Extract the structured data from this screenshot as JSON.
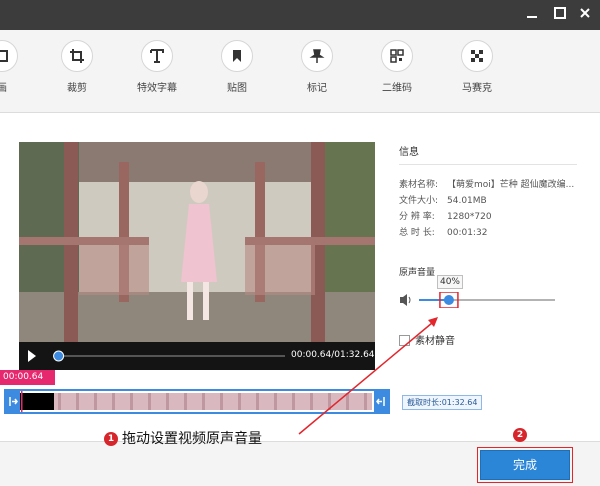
{
  "toolbar": {
    "items": [
      {
        "label": "画",
        "icon": "frame-icon"
      },
      {
        "label": "裁剪",
        "icon": "crop-icon"
      },
      {
        "label": "特效字幕",
        "icon": "text-icon"
      },
      {
        "label": "贴图",
        "icon": "bookmark-icon"
      },
      {
        "label": "标记",
        "icon": "pin-icon"
      },
      {
        "label": "二维码",
        "icon": "qrcode-icon"
      },
      {
        "label": "马赛克",
        "icon": "mosaic-icon"
      }
    ]
  },
  "player": {
    "time": "00:00.64/01:32.64",
    "progress": 0.007
  },
  "info": {
    "title": "信息",
    "rows": [
      {
        "key": "素材名称:",
        "value": "【萌爱moi】芒种 超仙魔改编..."
      },
      {
        "key": "文件大小:",
        "value": "54.01MB"
      },
      {
        "key": "分 辨 率:",
        "value": "1280*720"
      },
      {
        "key": "总 时 长:",
        "value": "00:01:32"
      }
    ]
  },
  "volume": {
    "label": "原声音量",
    "percent": "40%",
    "level": 0.4
  },
  "mute": {
    "label": "素材静音",
    "checked": false
  },
  "timeline": {
    "marker": "00:00.64",
    "cut_duration": "截取时长:01:32.64"
  },
  "annotation": {
    "step1_badge": "1",
    "step1_text": "拖动设置视频原声音量",
    "step2_badge": "2"
  },
  "footer": {
    "done_label": "完成"
  },
  "colors": {
    "accent": "#2b86d8",
    "annotation": "#e2262c",
    "marker": "#e6296f"
  }
}
